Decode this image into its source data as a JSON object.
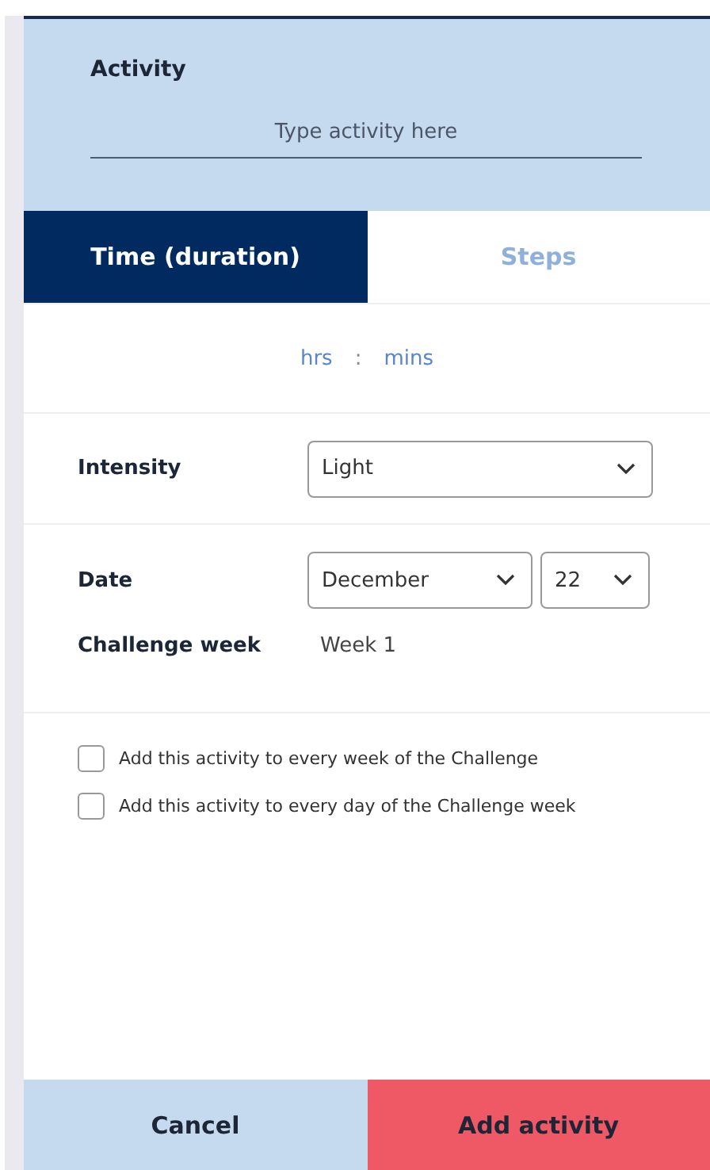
{
  "activity": {
    "label": "Activity",
    "placeholder": "Type activity here"
  },
  "tabs": [
    {
      "label": "Time (duration)",
      "selected": true
    },
    {
      "label": "Steps",
      "selected": false
    }
  ],
  "duration": {
    "hours": "hrs",
    "separator": ":",
    "minutes": "mins"
  },
  "intensity": {
    "label": "Intensity",
    "value": "Light"
  },
  "date": {
    "label": "Date",
    "month": "December",
    "day": "22"
  },
  "challenge_week": {
    "label": "Challenge week",
    "value": "Week 1"
  },
  "options": [
    {
      "label": "Add this activity to every week of the Challenge",
      "checked": false
    },
    {
      "label": "Add this activity to every day of the Challenge week",
      "checked": false
    }
  ],
  "buttons": [
    {
      "label": "Cancel",
      "kind": "secondary"
    },
    {
      "label": "Add activity",
      "kind": "primary"
    }
  ]
}
